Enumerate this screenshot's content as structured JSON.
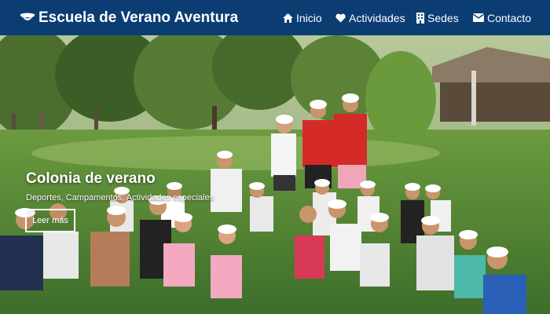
{
  "brand": {
    "title": "Escuela de Verano Aventura",
    "icon": "mustache-icon"
  },
  "nav": {
    "items": [
      {
        "label": "Inicio",
        "icon": "home-icon"
      },
      {
        "label": "Actividades",
        "icon": "heart-icon"
      },
      {
        "label": "Sedes",
        "icon": "building-icon"
      },
      {
        "label": "Contacto",
        "icon": "envelope-icon"
      }
    ]
  },
  "hero": {
    "title": "Colonia de verano",
    "subtitle": "Deportes, Campamentos, Actividades especiales",
    "button_label": "Leer más",
    "image": "group-photo-children-white-caps-on-grass"
  },
  "colors": {
    "navbar": "#0b3d73",
    "text": "#ffffff",
    "grass": "#3f7d34"
  }
}
